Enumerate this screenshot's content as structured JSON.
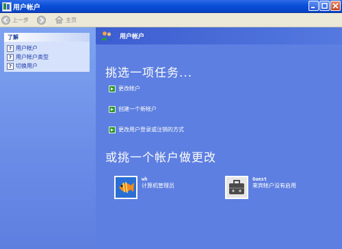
{
  "window": {
    "title": "用户帐户"
  },
  "toolbar": {
    "back_label": "上一步",
    "home_label": "主页"
  },
  "sidebar": {
    "section_title": "了解",
    "items": [
      {
        "label": "用户帐户"
      },
      {
        "label": "用户帐户类型"
      },
      {
        "label": "切换用户"
      }
    ]
  },
  "main": {
    "header_title": "用户帐户",
    "pick_task_heading": "挑选一项任务...",
    "tasks": [
      {
        "label": "更改帐户"
      },
      {
        "label": "创建一个新帐户"
      },
      {
        "label": "更改用户登录或注销的方式"
      }
    ],
    "pick_account_heading": "或挑一个帐户做更改",
    "accounts": [
      {
        "name": "wh",
        "type": "计算机管理员",
        "picture": "fish-icon"
      },
      {
        "name": "Guest",
        "type": "来宾帐户没有启用",
        "picture": "briefcase-icon"
      }
    ]
  },
  "colors": {
    "titlebar": "#0a4fd8",
    "sidebar": "#7ea3f0",
    "main_bg": "#5d7fe1",
    "task_arrow": "#2c9a2c"
  }
}
